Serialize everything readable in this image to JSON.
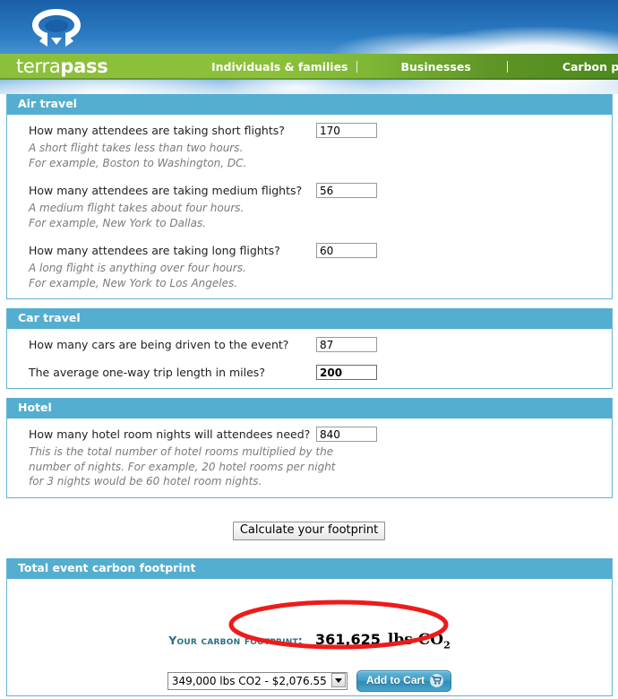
{
  "header": {
    "brand_light": "terra",
    "brand_bold": "pass",
    "logo_icon": "terrapass-swirl-logo-icon",
    "nav": [
      {
        "label": "Individuals & families"
      },
      {
        "label": "Businesses"
      },
      {
        "label": "Carbon project"
      }
    ]
  },
  "sections": [
    {
      "title": "Air travel",
      "questions": [
        {
          "label": "How many attendees are taking short flights?",
          "value": "170",
          "focused": false,
          "help": [
            "A short flight takes less than two hours.",
            "For example, Boston to Washington, DC."
          ]
        },
        {
          "label": "How many attendees are taking medium flights?",
          "value": "56",
          "focused": false,
          "help": [
            "A medium flight takes about four hours.",
            "For example, New York to Dallas."
          ]
        },
        {
          "label": "How many attendees are taking long flights?",
          "value": "60",
          "focused": false,
          "help": [
            "A long flight is anything over four hours.",
            "For example, New York to Los Angeles."
          ]
        }
      ]
    },
    {
      "title": "Car travel",
      "questions": [
        {
          "label": "How many cars are being driven to the event?",
          "value": "87",
          "focused": false,
          "help": []
        },
        {
          "label": "The average one-way trip length in miles?",
          "value": "200",
          "focused": true,
          "help": []
        }
      ]
    },
    {
      "title": "Hotel",
      "questions": [
        {
          "label": "How many hotel room nights will attendees need?",
          "value": "840",
          "focused": false,
          "help": [
            "This is the total number of hotel rooms multiplied by the",
            "number of nights. For example, 20 hotel rooms per night",
            "for 3 nights would be 60 hotel room nights."
          ]
        }
      ]
    }
  ],
  "calculate": {
    "label": "Calculate your footprint"
  },
  "total": {
    "title": "Total event carbon footprint",
    "footprint_label": "Your carbon footprint:",
    "footprint_value": "361,625",
    "footprint_unit": "lbs CO",
    "footprint_unit_sub": "2",
    "highlight_color": "#ee1b1b",
    "offset_option": "349,000 lbs CO2 - $2,076.55",
    "add_to_cart_label": "Add to Cart",
    "cart_icon": "shopping-cart-icon"
  },
  "colors": {
    "section_header": "#54aed0",
    "nav_green": "#8cc03a",
    "sky_blue": "#1a5fa8",
    "footprint_label": "#2c6e7f"
  }
}
